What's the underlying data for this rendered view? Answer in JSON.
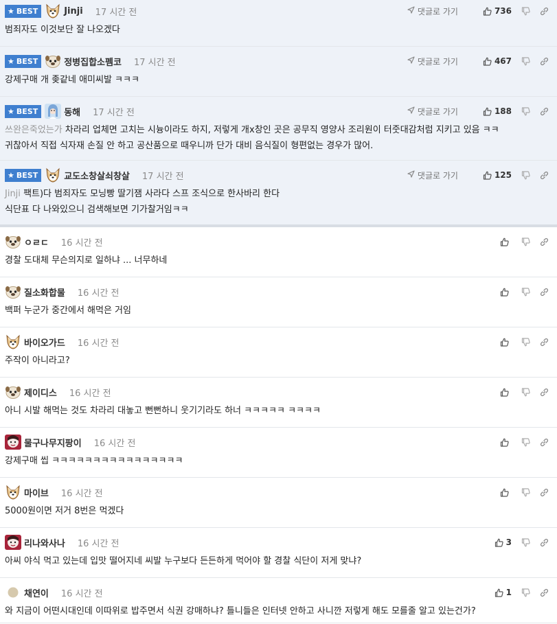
{
  "best_label": "BEST",
  "goto_label": "댓글로 가기",
  "best_comments": [
    {
      "nick": "Jinji",
      "time": "17 시간 전",
      "likes": "736",
      "avatar": "dog",
      "reply_to": "",
      "lines": [
        "범죄자도 이것보단 잘 나오겠다"
      ]
    },
    {
      "nick": "정병집합소펨코",
      "time": "17 시간 전",
      "likes": "467",
      "avatar": "pug",
      "reply_to": "",
      "lines": [
        "강제구매 개 좆같네 애미씨발 ㅋㅋㅋ"
      ]
    },
    {
      "nick": "동해",
      "time": "17 시간 전",
      "likes": "188",
      "avatar": "girl",
      "reply_to": "쓰완은죽었는가",
      "lines": [
        "차라리 업체면 고치는 시늉이라도 하지, 저렇게 개x창인 곳은 공무직 영양사 조리원이 터줏대감처럼 지키고 있음 ㅋㅋ",
        "귀찮아서 직접 식자재 손질 안 하고 공산품으로 때우니까 단가 대비 음식질이 형편없는 경우가 많어."
      ]
    },
    {
      "nick": "교도소창살쇠창살",
      "time": "17 시간 전",
      "likes": "125",
      "avatar": "dog",
      "reply_to": "Jinji",
      "lines": [
        "팩트)다 범죄자도 모닝빵 딸기잼 사라다 스프 조식으로 한사바리 한다",
        "식단표 다 나와있으니 검색해보면 기가찰거임ㅋㅋ"
      ]
    }
  ],
  "comments": [
    {
      "nick": "ㅇㄹㄷ",
      "time": "16 시간 전",
      "likes": "",
      "avatar": "pug",
      "text": "경찰 도대체 무슨의지로 일하냐 ... 너무하네"
    },
    {
      "nick": "질소화합물",
      "time": "16 시간 전",
      "likes": "",
      "avatar": "pug",
      "text": "백퍼 누군가 중간에서 해먹은 거임"
    },
    {
      "nick": "바이오가드",
      "time": "16 시간 전",
      "likes": "",
      "avatar": "dog",
      "text": "주작이 아니라고?"
    },
    {
      "nick": "제이디스",
      "time": "16 시간 전",
      "likes": "",
      "avatar": "pug",
      "text": "아니 시발 해먹는 것도 차라리 대놓고 뻔뻔하니 웃기기라도 하너 ㅋㅋㅋㅋㅋ ㅋㅋㅋㅋ"
    },
    {
      "nick": "물구나무지팡이",
      "time": "16 시간 전",
      "likes": "",
      "avatar": "red",
      "text": "강제구매 씹 ㅋㅋㅋㅋㅋㅋㅋㅋㅋㅋㅋㅋㅋㅋㅋㅋ"
    },
    {
      "nick": "마이브",
      "time": "16 시간 전",
      "likes": "",
      "avatar": "dog",
      "text": "5000원이면 저거 8번은 먹겠다"
    },
    {
      "nick": "리나와사나",
      "time": "16 시간 전",
      "likes": "3",
      "avatar": "red",
      "text": "아씨 야식 먹고 있는데 입맛 떨어지네 씨발 누구보다 든든하게 먹어야 할 경찰 식단이 저게 맞냐?"
    },
    {
      "nick": "채연이",
      "time": "16 시간 전",
      "likes": "1",
      "avatar": "circle",
      "text": "와 지금이 어떤시대인데 이따위로 밥주면서 식권 강매하냐? 틀니들은 인터넷 안하고 사니깐 저렇게 해도 모를줄 알고 있는건가?"
    }
  ],
  "colors": {
    "accent": "#3f7fcf",
    "best_bg": "#eef2f8"
  },
  "icons": [
    "star-icon",
    "arrow-icon",
    "thumbs-up-icon",
    "thumbs-down-icon",
    "link-icon"
  ]
}
